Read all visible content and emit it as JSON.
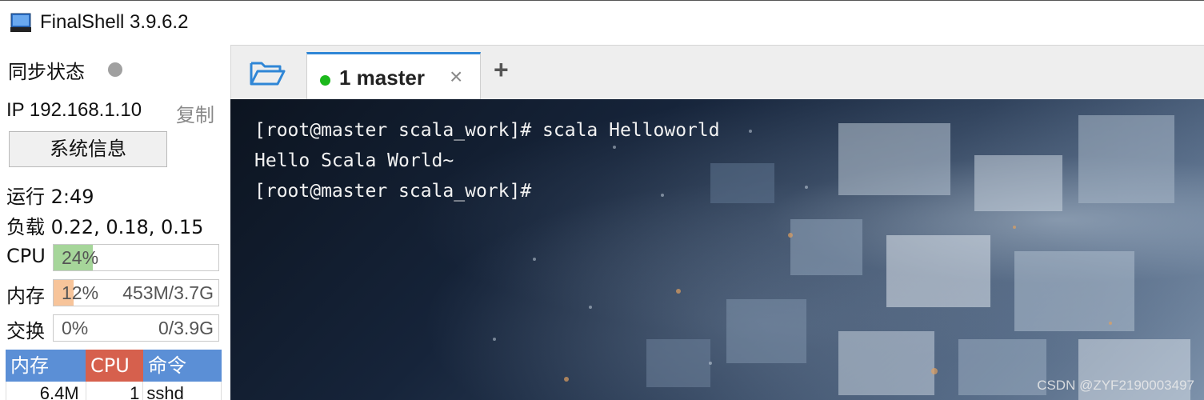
{
  "window": {
    "title": "FinalShell 3.9.6.2",
    "icon": "finalshell-monitor-icon"
  },
  "sidebar": {
    "sync_label": "同步状态",
    "sync_status_color": "#a0a0a0",
    "ip_text": "IP 192.168.1.10",
    "copy_label": "复制",
    "sysinfo_button": "系统信息",
    "uptime_text": "运行 2:49",
    "load_text": "负载 0.22, 0.18, 0.15",
    "meters": [
      {
        "label": "CPU",
        "percent_text": "24%",
        "percent": 24,
        "detail": "",
        "color": "#a6d69a"
      },
      {
        "label": "内存",
        "percent_text": "12%",
        "percent": 12,
        "detail": "453M/3.7G",
        "color": "#f7c49a"
      },
      {
        "label": "交换",
        "percent_text": "0%",
        "percent": 0,
        "detail": "0/3.9G",
        "color": "#a6d69a"
      }
    ],
    "process_table": {
      "headers": {
        "mem": "内存",
        "cpu": "CPU",
        "cmd": "命令"
      },
      "rows": [
        {
          "mem": "6.4M",
          "cpu": "1",
          "cmd": "sshd"
        }
      ]
    }
  },
  "tabbar": {
    "folder_icon": "folder-open-icon",
    "tabs": [
      {
        "label": "1 master",
        "status_color": "#1bb81b",
        "active": true
      }
    ],
    "close_glyph": "×",
    "add_glyph": "+"
  },
  "terminal": {
    "lines": [
      "[root@master scala_work]# scala Helloworld",
      "Hello Scala World~",
      "[root@master scala_work]#"
    ],
    "watermark": "CSDN @ZYF2190003497"
  }
}
